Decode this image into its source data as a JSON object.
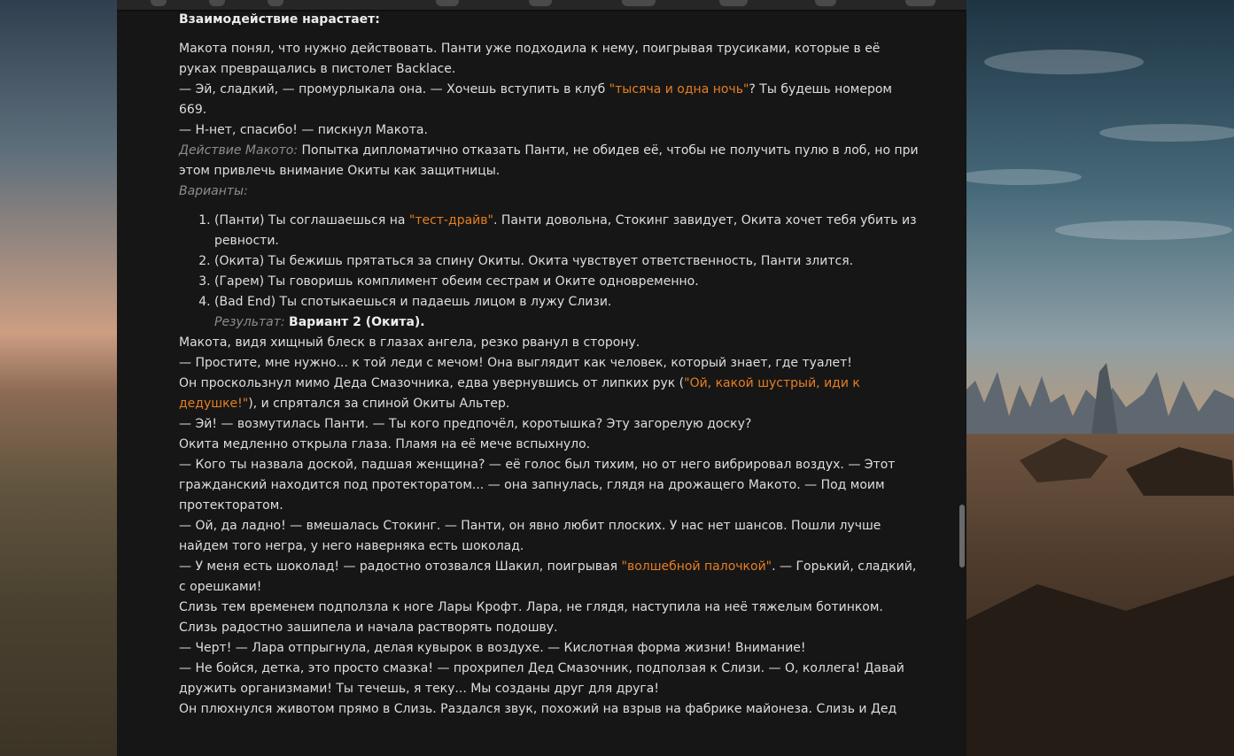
{
  "toolbar": {
    "icons": [
      "toolbar-icon-1",
      "toolbar-icon-2",
      "toolbar-icon-3",
      "toolbar-icon-4",
      "toolbar-icon-5",
      "toolbar-icon-6",
      "toolbar-icon-7",
      "toolbar-icon-8",
      "toolbar-icon-9"
    ]
  },
  "colors": {
    "panel": "#161616",
    "text": "#dedede",
    "highlight": "#e67e22",
    "label": "#8c8c8c"
  },
  "story": {
    "heading": "Взаимодействие нарастает:",
    "intro": {
      "line1": "Макота понял, что нужно действовать. Панти уже подходила к нему, поигрывая трусиками, которые в её руках превращались в пистолет Backlace.",
      "line2_a": "— Эй, сладкий, — промурлыкала она. — Хочешь вступить в клуб ",
      "line2_hl": "\"тысяча и одна ночь\"",
      "line2_b": "? Ты будешь номером 669.",
      "line3": "— Н-нет, спасибо! — пискнул Макота."
    },
    "action": {
      "label": "Действие Макото:",
      "text": " Попытка дипломатично отказать Панти, не обидев её, чтобы не получить пулю в лоб, но при этом привлечь внимание Окиты как защитницы."
    },
    "variants_label": "Варианты:",
    "options": {
      "o1_a": "(Панти) Ты соглашаешься на ",
      "o1_hl": "\"тест-драйв\"",
      "o1_b": ". Панти довольна, Стокинг завидует, Окита хочет тебя убить из ревности.",
      "o2": "(Окита) Ты бежишь прятаться за спину Окиты. Окита чувствует ответственность, Панти злится.",
      "o3": "(Гарем) Ты говоришь комплимент обеим сестрам и Оките одновременно.",
      "o4": "(Bad End) Ты спотыкаешься и падаешь лицом в лужу Слизи."
    },
    "result": {
      "label": "Результат:",
      "value": "Вариант 2 (Окита)."
    },
    "part2": {
      "p1": "Макота, видя хищный блеск в глазах ангела, резко рванул в сторону.",
      "p2": "— Простите, мне нужно... к той леди с мечом! Она выглядит как человек, который знает, где туалет!",
      "p3_a": "Он проскользнул мимо Деда Смазочника, едва увернувшись от липких рук (",
      "p3_hl": "\"Ой, какой шустрый, иди к дедушке!\"",
      "p3_b": "), и спрятался за спиной Окиты Альтер.",
      "p4": "— Эй! — возмутилась Панти. — Ты кого предпочёл, коротышка? Эту загорелую доску?",
      "p5": "Окита медленно открыла глаза. Пламя на её мече вспыхнуло.",
      "p6": "— Кого ты назвала доской, падшая женщина? — её голос был тихим, но от него вибрировал воздух. — Этот гражданский находится под протекторатом... — она запнулась, глядя на дрожащего Макото. — Под моим протекторатом.",
      "p7": "— Ой, да ладно! — вмешалась Стокинг. — Панти, он явно любит плоских. У нас нет шансов. Пошли лучше найдем того негра, у него наверняка есть шоколад.",
      "p8_a": "— У меня есть шоколад! — радостно отозвался Шакил, поигрывая ",
      "p8_hl": "\"волшебной палочкой\"",
      "p8_b": ". — Горький, сладкий, с орешками!"
    },
    "part3": {
      "p1": "Слизь тем временем подползла к ноге Лары Крофт. Лара, не глядя, наступила на неё тяжелым ботинком. Слизь радостно зашипела и начала растворять подошву.",
      "p2": "— Черт! — Лара отпрыгнула, делая кувырок в воздухе. — Кислотная форма жизни! Внимание!",
      "p3": "— Не бойся, детка, это просто смазка! — прохрипел Дед Смазочник, подползая к Слизи. — О, коллега! Давай дружить организмами! Ты течешь, я теку... Мы созданы друг для друга!",
      "p4": "Он плюхнулся животом прямо в Слизь. Раздался звук, похожий на взрыв на фабрике майонеза. Слизь и Дед"
    }
  }
}
